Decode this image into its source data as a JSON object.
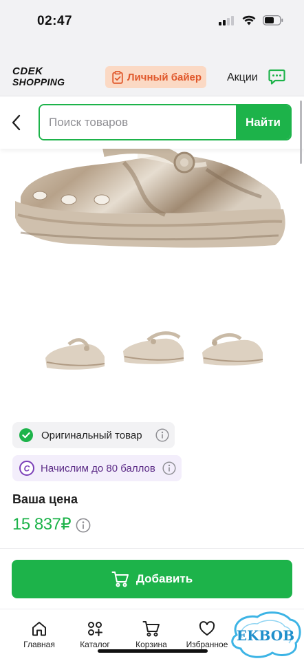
{
  "status_bar": {
    "time": "02:47"
  },
  "header": {
    "logo_top": "CDEK",
    "logo_bottom": "SHOPPING",
    "buyer_button_label": "Личный байер",
    "promo_link": "Акции"
  },
  "search": {
    "placeholder": "Поиск товаров",
    "value": "",
    "button_label": "Найти"
  },
  "badges": {
    "original": "Оригинальный товар",
    "points": "Начислим до 80 баллов",
    "points_symbol": "C"
  },
  "price": {
    "label": "Ваша цена",
    "value": "15 837₽"
  },
  "add_button_label": "Добавить",
  "bottom_nav": {
    "items": [
      {
        "label": "Главная",
        "icon": "home-icon"
      },
      {
        "label": "Каталог",
        "icon": "catalog-icon"
      },
      {
        "label": "Корзина",
        "icon": "cart-icon"
      },
      {
        "label": "Избранное",
        "icon": "heart-icon"
      }
    ]
  },
  "watermark": "EKBOB",
  "colors": {
    "brand_green": "#1db34a",
    "buyer_bg": "#fbd9c4",
    "buyer_text": "#e0572a",
    "points_bg": "#f3eefb",
    "points_accent": "#7b3fb8"
  }
}
